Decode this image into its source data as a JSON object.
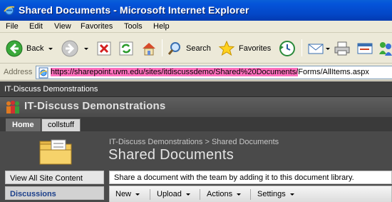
{
  "window": {
    "title": "Shared Documents - Microsoft Internet Explorer"
  },
  "menu": [
    "File",
    "Edit",
    "View",
    "Favorites",
    "Tools",
    "Help"
  ],
  "toolbar": {
    "back_label": "Back",
    "search_label": "Search",
    "favorites_label": "Favorites"
  },
  "address": {
    "label": "Address",
    "url_highlighted": "https://sharepoint.uvm.edu/sites/itdiscussdemo/Shared%20Documents/",
    "url_rest": "Forms/AllItems.aspx"
  },
  "sharepoint": {
    "top_crumb": "IT-Discuss Demonstrations",
    "site_title": "IT-Discuss Demonstrations",
    "tabs": [
      "Home",
      "collstuff"
    ],
    "page_breadcrumb": "IT-Discuss Demonstrations > Shared Documents",
    "page_title": "Shared Documents",
    "left_nav": [
      "View All Site Content",
      "Discussions"
    ],
    "description": "Share a document with the team by adding it to this document library.",
    "actions": [
      "New",
      "Upload",
      "Actions",
      "Settings"
    ]
  },
  "colors": {
    "titlebar": "#0454d9",
    "url_highlight": "#ff6fbd",
    "sp_dark": "#4a4a4a"
  }
}
